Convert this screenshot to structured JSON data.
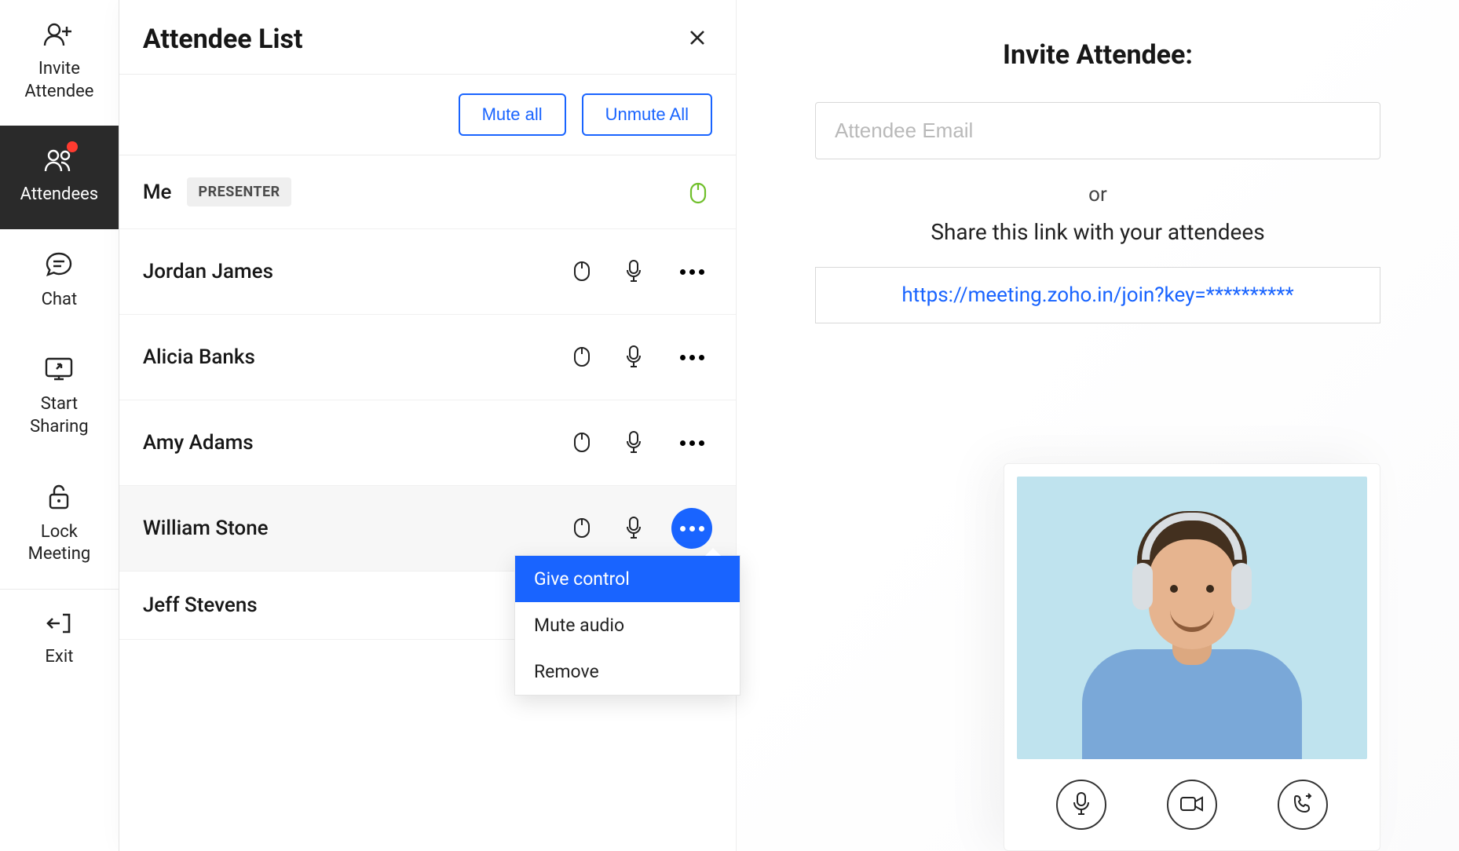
{
  "sidebar": {
    "items": [
      {
        "label": "Invite\nAttendee"
      },
      {
        "label": "Attendees"
      },
      {
        "label": "Chat"
      },
      {
        "label": "Start\nSharing"
      },
      {
        "label": "Lock\nMeeting"
      },
      {
        "label": "Exit"
      }
    ]
  },
  "panel": {
    "title": "Attendee List",
    "mute_all": "Mute all",
    "unmute_all": "Unmute All",
    "presenter_badge": "PRESENTER",
    "rows": [
      {
        "name": "Me"
      },
      {
        "name": "Jordan James"
      },
      {
        "name": "Alicia Banks"
      },
      {
        "name": "Amy Adams"
      },
      {
        "name": "William Stone"
      },
      {
        "name": "Jeff Stevens"
      }
    ],
    "dropdown": {
      "give_control": "Give control",
      "mute_audio": "Mute audio",
      "remove": "Remove"
    }
  },
  "invite": {
    "title": "Invite Attendee:",
    "placeholder": "Attendee Email",
    "or": "or",
    "share_text": "Share this link with your attendees",
    "link": "https://meeting.zoho.in/join?key=**********"
  }
}
